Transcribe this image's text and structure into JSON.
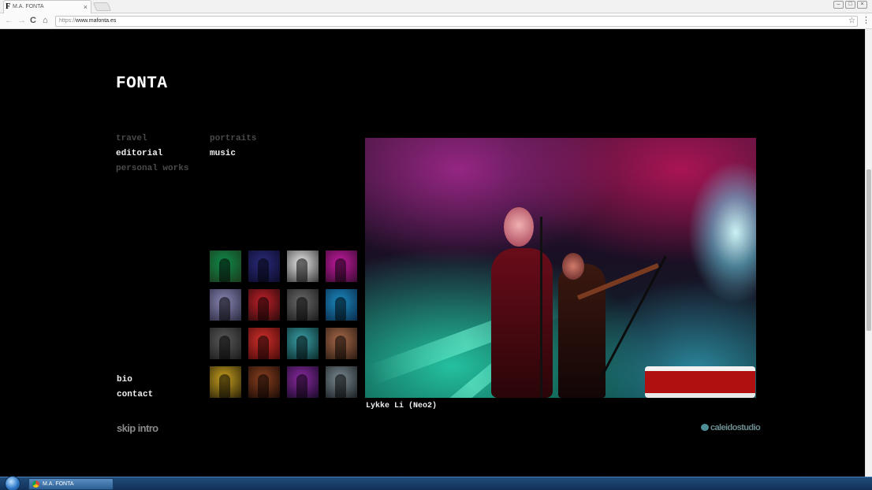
{
  "browser": {
    "tab_title": "M.A. FONTA",
    "tab_favicon": "F",
    "tab_close": "×",
    "url_scheme": "https://",
    "url_host": "www.mafonta.es",
    "back_glyph": "←",
    "forward_glyph": "→",
    "reload_glyph": "C",
    "home_glyph": "⌂",
    "star_glyph": "☆",
    "menu_glyph": "⋮",
    "window_minimize": "–",
    "window_restore": "□",
    "window_close": "×"
  },
  "site": {
    "logo": "FONTA",
    "menu_left": [
      {
        "label": "travel",
        "state": "dim"
      },
      {
        "label": "editorial",
        "state": "lit"
      },
      {
        "label": "personal works",
        "state": "dim"
      }
    ],
    "menu_right": [
      {
        "label": "portraits",
        "state": "dim"
      },
      {
        "label": "music",
        "state": "lit"
      }
    ],
    "bottom_links": [
      {
        "label": "bio"
      },
      {
        "label": "contact"
      }
    ],
    "thumbnails": [
      {
        "colors": [
          "#0f8a4a",
          "#1b3a1c"
        ]
      },
      {
        "colors": [
          "#2a2a7a",
          "#0c0c2a"
        ]
      },
      {
        "colors": [
          "#e8e8e8",
          "#3a3a3a"
        ]
      },
      {
        "colors": [
          "#c21aa0",
          "#3a0a30"
        ]
      },
      {
        "colors": [
          "#8a86b4",
          "#2a2a40"
        ]
      },
      {
        "colors": [
          "#c0202a",
          "#2a0a0a"
        ]
      },
      {
        "colors": [
          "#6a6a6a",
          "#1a1a1a"
        ]
      },
      {
        "colors": [
          "#1a8ac0",
          "#0a2a4a"
        ]
      },
      {
        "colors": [
          "#5a5a5a",
          "#1a1a1a"
        ]
      },
      {
        "colors": [
          "#d0302a",
          "#4a0a0a"
        ]
      },
      {
        "colors": [
          "#3aa0a8",
          "#0a2a2a"
        ]
      },
      {
        "colors": [
          "#a86a4a",
          "#2a1a10"
        ]
      },
      {
        "colors": [
          "#c8a020",
          "#2a2208"
        ]
      },
      {
        "colors": [
          "#8a4020",
          "#1a0a04"
        ]
      },
      {
        "colors": [
          "#8a2aa0",
          "#1a0a2a"
        ]
      },
      {
        "colors": [
          "#7a8a90",
          "#1a2024"
        ]
      }
    ],
    "caption": "Lykke Li (Neo2)",
    "skip_intro": "skip intro",
    "studio": "caleidostudio"
  },
  "taskbar": {
    "item_label": "M.A. FONTA"
  }
}
